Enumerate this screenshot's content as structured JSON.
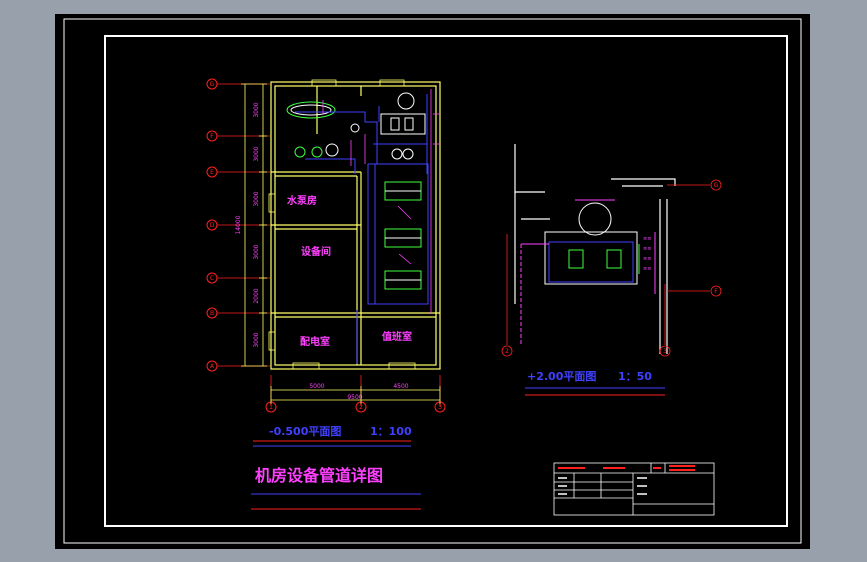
{
  "drawing": {
    "title": "机房设备管道详图",
    "plan_left": {
      "caption": "-0.500平面图",
      "scale": "1：100",
      "rooms": {
        "pump": "水泵房",
        "equipment": "设备间",
        "power": "配电室",
        "duty": "值班室"
      },
      "row_axes": [
        "G",
        "F",
        "E",
        "D",
        "C",
        "B",
        "A"
      ],
      "col_axes": [
        "1",
        "2",
        "3"
      ],
      "dims_left": [
        "3000",
        "3000",
        "3000",
        "3000",
        "2000",
        "3000"
      ],
      "dim_total": "14000",
      "dims_bottom": [
        "5000",
        "4500"
      ],
      "dim_bottom_total": "9500"
    },
    "plan_right": {
      "caption": "+2.00平面图",
      "scale": "1：50",
      "axes": [
        "G",
        "F",
        "2",
        "3"
      ]
    },
    "colors": {
      "background": "#000000",
      "border": "#ffffff",
      "wall": "#ffff66",
      "axis": "#ff2020",
      "text_magenta": "#ff40ff",
      "pipe_blue": "#4040ff",
      "equip_green": "#40ff40",
      "equip_white": "#ffffff"
    }
  }
}
